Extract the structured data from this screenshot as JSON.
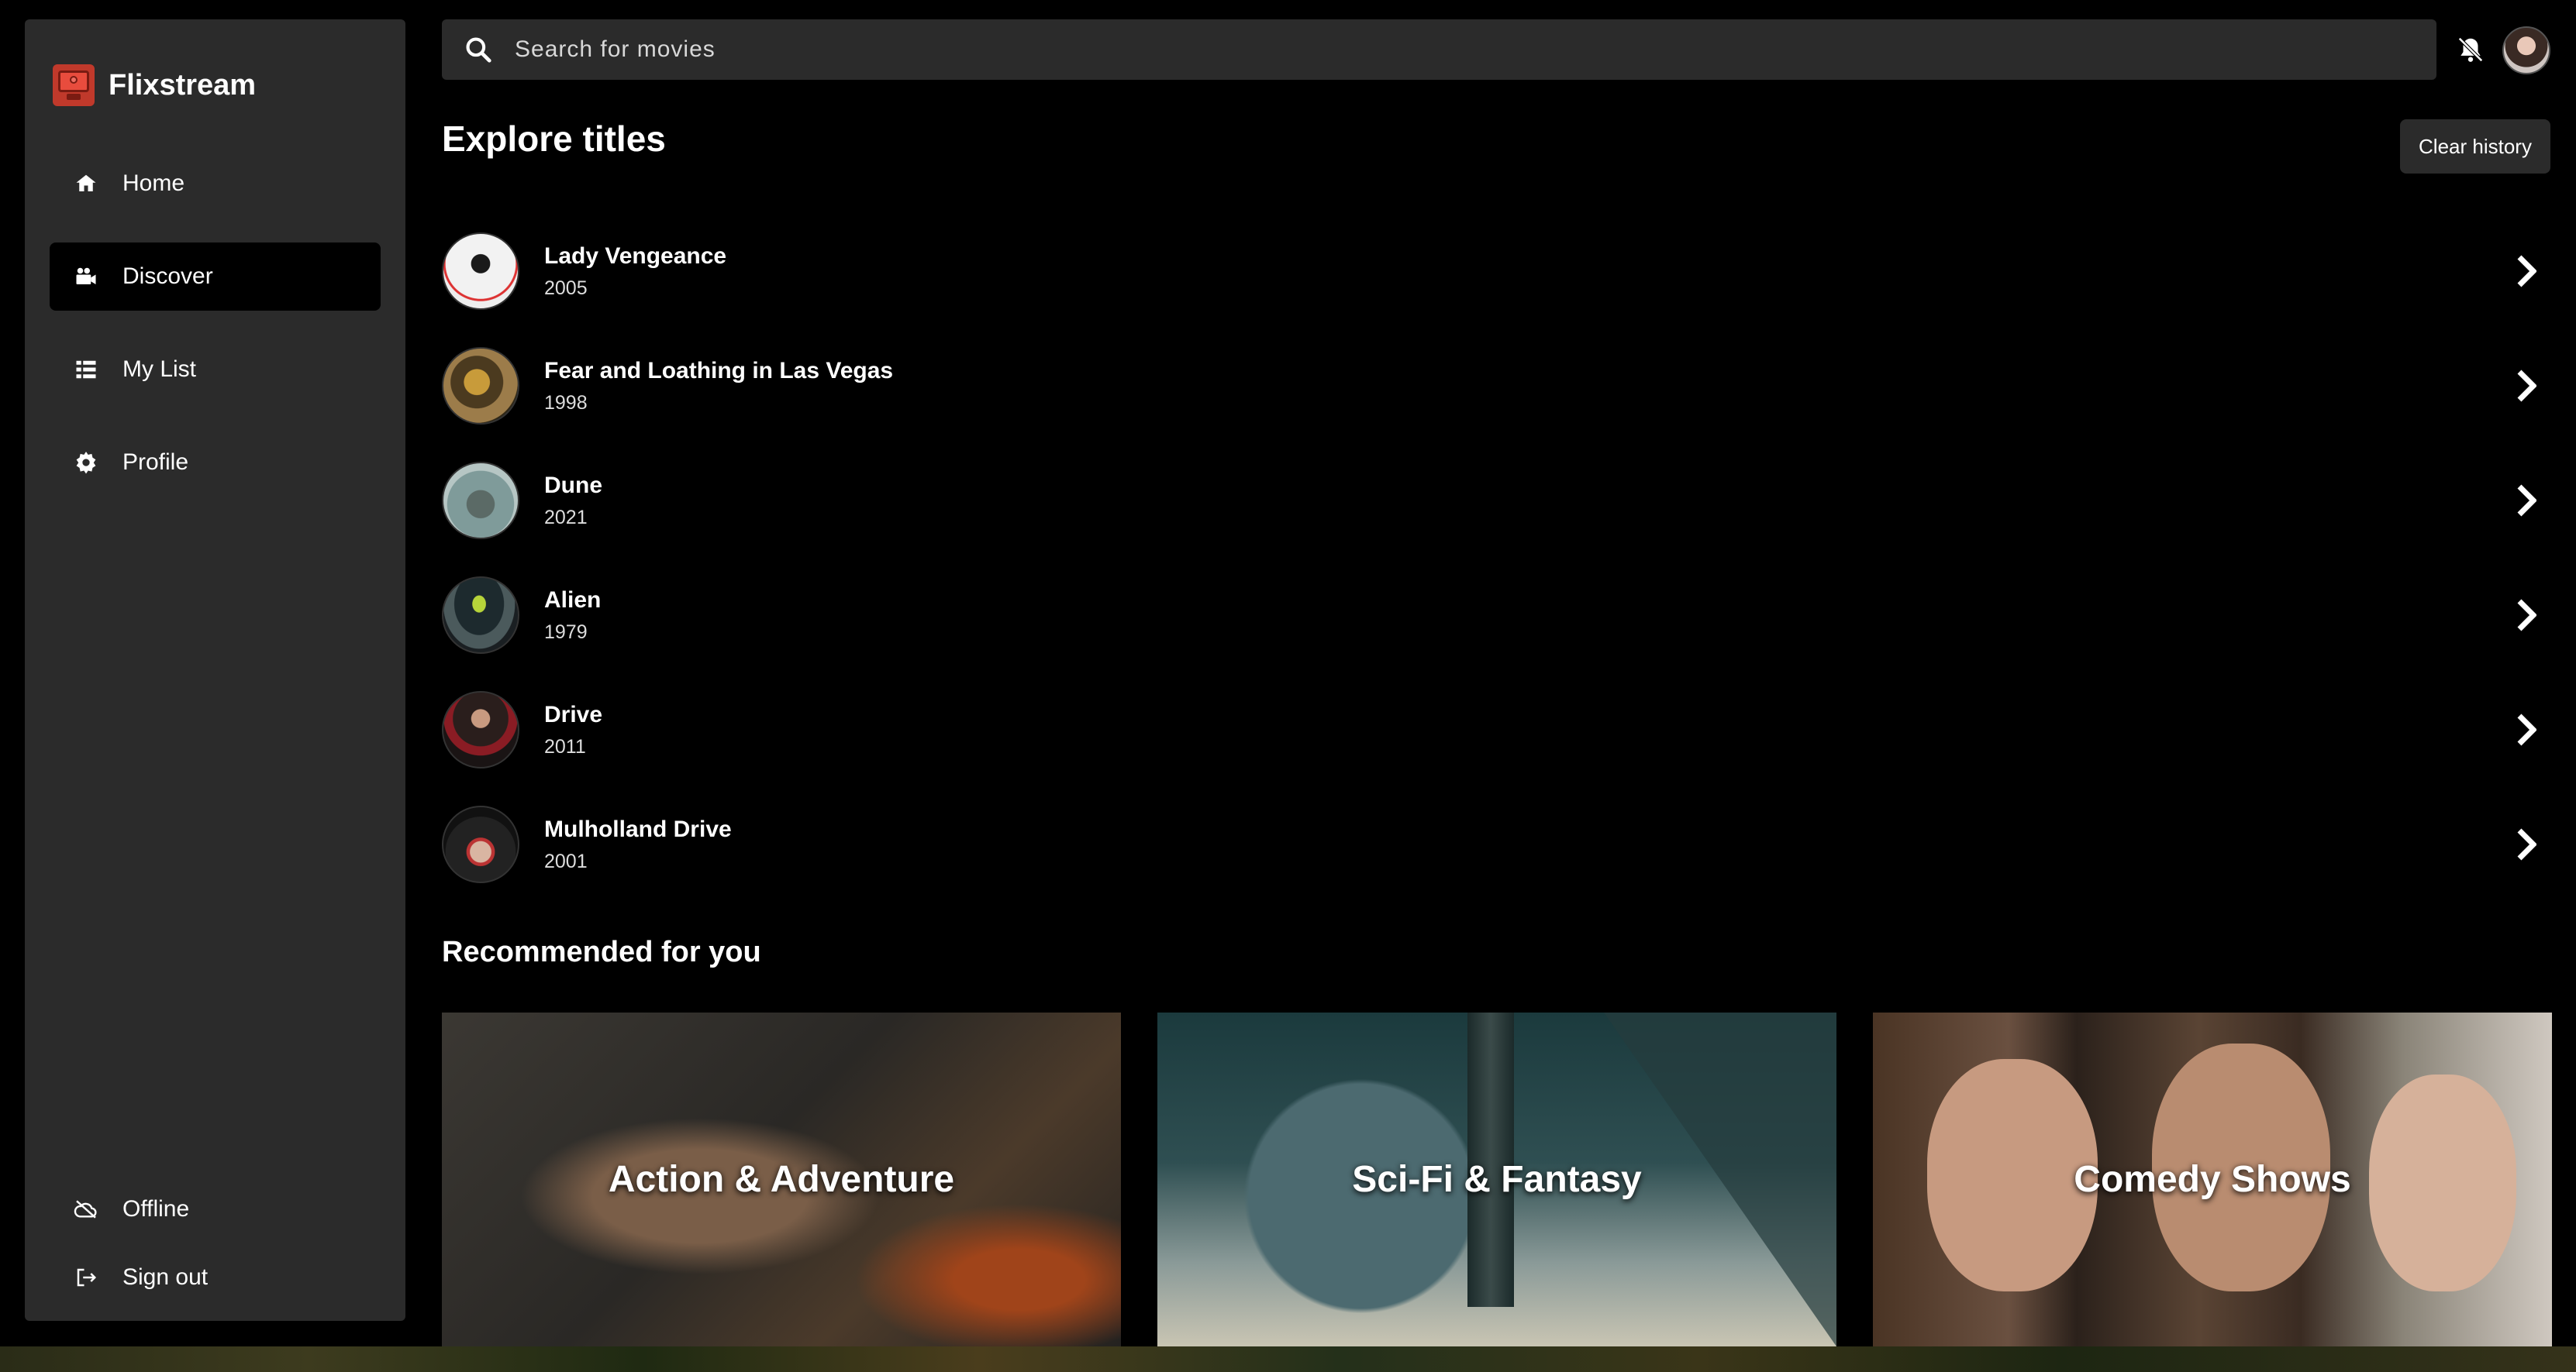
{
  "app": {
    "name": "Flixstream",
    "logo_icon": "tv-icon",
    "accent_color": "#c0392b"
  },
  "sidebar": {
    "items": [
      {
        "label": "Home",
        "icon": "home-icon",
        "active": false
      },
      {
        "label": "Discover",
        "icon": "video-camera-icon",
        "active": true
      },
      {
        "label": "My List",
        "icon": "list-icon",
        "active": false
      },
      {
        "label": "Profile",
        "icon": "gear-icon",
        "active": false
      }
    ],
    "bottom_items": [
      {
        "label": "Offline",
        "icon": "cloud-off-icon"
      },
      {
        "label": "Sign out",
        "icon": "sign-out-icon"
      }
    ]
  },
  "search": {
    "placeholder": "Search for movies",
    "value": ""
  },
  "header": {
    "notifications_icon": "bell-off-icon",
    "avatar_icon": "avatar"
  },
  "explore": {
    "title": "Explore titles",
    "clear_label": "Clear history",
    "items": [
      {
        "title": "Lady Vengeance",
        "year": "2005"
      },
      {
        "title": "Fear and Loathing in Las Vegas",
        "year": "1998"
      },
      {
        "title": "Dune",
        "year": "2021"
      },
      {
        "title": "Alien",
        "year": "1979"
      },
      {
        "title": "Drive",
        "year": "2011"
      },
      {
        "title": "Mulholland Drive",
        "year": "2001"
      }
    ]
  },
  "recommended": {
    "title": "Recommended for you",
    "cards": [
      {
        "label": "Action & Adventure"
      },
      {
        "label": "Sci-Fi & Fantasy"
      },
      {
        "label": "Comedy Shows"
      }
    ]
  }
}
